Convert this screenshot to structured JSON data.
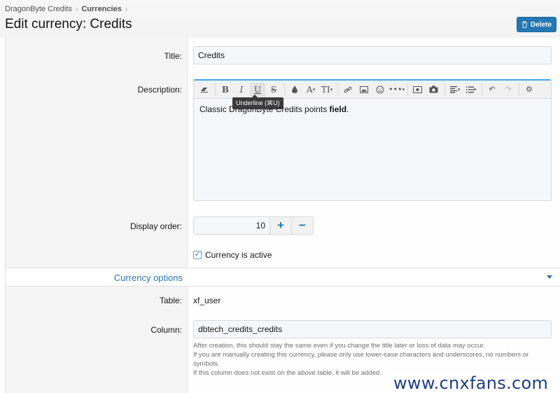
{
  "breadcrumb": {
    "items": [
      "DragonByte Credits",
      "Currencies"
    ]
  },
  "header": {
    "title": "Edit currency: Credits",
    "delete_label": "Delete"
  },
  "form": {
    "title": {
      "label": "Title:",
      "value": "Credits"
    },
    "description": {
      "label": "Description:",
      "content_plain": "Classic DragonByte Credits points ",
      "content_bold": "field",
      "content_end": "."
    },
    "editor_toolbar": {
      "buttons": [
        "eraser-icon",
        "bold-icon",
        "italic-icon",
        "underline-icon",
        "strikethrough-icon",
        "color-icon",
        "font-family-icon",
        "font-size-icon",
        "link-icon",
        "image-icon",
        "smilie-icon",
        "more-icon",
        "media-icon",
        "camera-icon",
        "align-icon",
        "list-icon",
        "undo-icon",
        "redo-icon",
        "settings-icon"
      ],
      "bold": "B",
      "italic": "I",
      "underline": "U",
      "strike": "S",
      "font": "A",
      "size": "TI",
      "tooltip": "Underline (⌘U)"
    },
    "display_order": {
      "label": "Display order:",
      "value": "10",
      "plus": "+",
      "minus": "−"
    },
    "active": {
      "label": "Currency is active",
      "checked": true,
      "check_glyph": "✓"
    }
  },
  "section": {
    "title": "Currency options",
    "table": {
      "label": "Table:",
      "value": "xf_user"
    },
    "column": {
      "label": "Column:",
      "value": "dbtech_credits_credits",
      "hint1": "After creation, this should stay the same even if you change the title later or loss of data may occur.",
      "hint2": "If you are manually creating this currency, please only use lower-case characters and underscores, no numbers or symbols.",
      "hint3": "If this column does not exist on the above table, it will be added."
    }
  },
  "watermark": "www.cnxfans.com",
  "colors": {
    "accent": "#2577b1",
    "editor_border": "#47a7eb",
    "label_bg": "#f5f5f5"
  }
}
